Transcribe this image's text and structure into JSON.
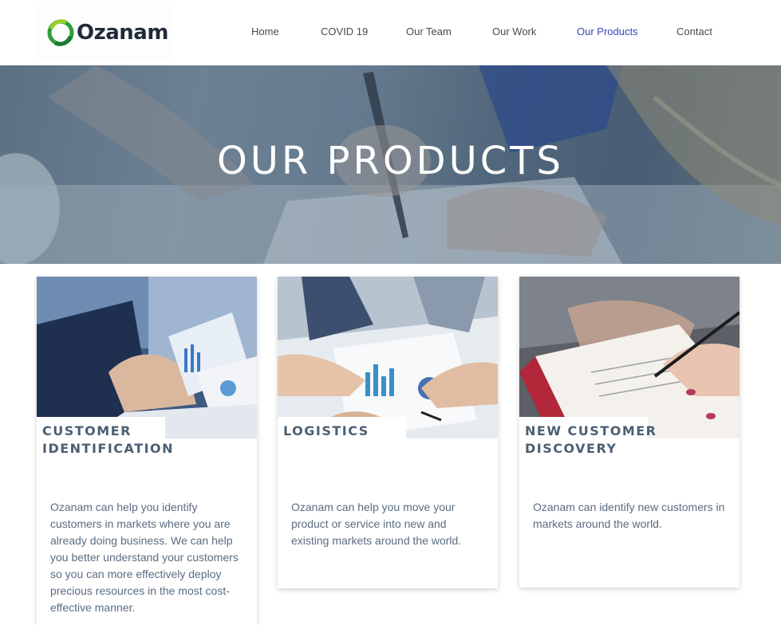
{
  "brand": {
    "name": "Ozanam",
    "accent": "#3b46b4",
    "logo_green": "#2e9e3a"
  },
  "nav": {
    "items": [
      {
        "label": "Home"
      },
      {
        "label": "COVID 19"
      },
      {
        "label": "Our Team"
      },
      {
        "label": "Our Work"
      },
      {
        "label": "Our Products",
        "active": true
      },
      {
        "label": "Contact"
      }
    ]
  },
  "hero": {
    "title": "OUR PRODUCTS"
  },
  "cards": [
    {
      "title": "CUSTOMER IDENTIFICATION",
      "text": "Ozanam can help you identify customers in markets where you are already doing business. We can help you better understand your customers so you can more effectively deploy precious resources in the most cost-effective manner.",
      "image": "business-people-tablet-chart"
    },
    {
      "title": "LOGISTICS",
      "text": "Ozanam can help you move your product or service into new and existing markets around the world.",
      "image": "team-reviewing-charts"
    },
    {
      "title": "NEW CUSTOMER DISCOVERY",
      "text": "Ozanam can identify new customers in markets around the world.",
      "image": "hand-signing-document"
    }
  ]
}
